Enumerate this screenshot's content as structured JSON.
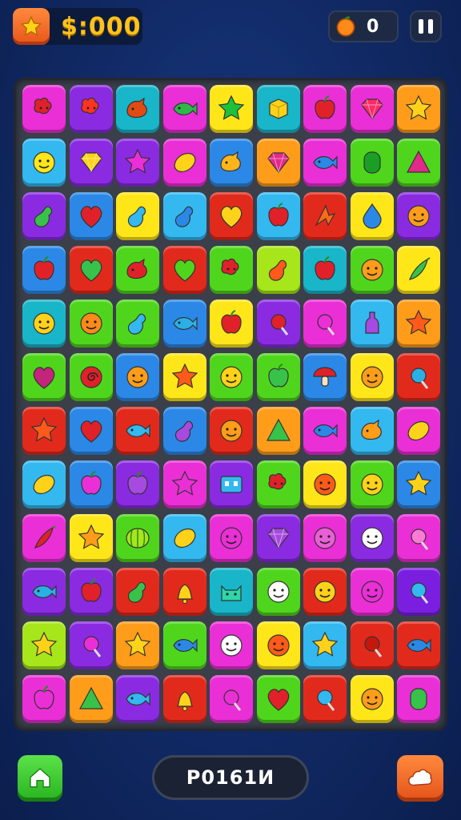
{
  "hud": {
    "coins": "$:000",
    "hearts": "0"
  },
  "bottom": {
    "status_label": "P0161И"
  },
  "colors": {
    "red": "#e22a1c",
    "purple": "#8a2be2",
    "teal": "#19b5c9",
    "magenta": "#ea2fd6",
    "yellow": "#ffe619",
    "blue": "#2b88e6",
    "orange": "#ff9d1a",
    "green": "#4fd61c",
    "sky": "#33b8f0",
    "lime": "#a6e61a",
    "darkred": "#c4180f",
    "violet": "#7a1fe0"
  },
  "board": {
    "rows": [
      [
        [
          "magenta",
          "blob",
          "#e0212a"
        ],
        [
          "purple",
          "blob",
          "#ff3322"
        ],
        [
          "teal",
          "bird",
          "#e24a12"
        ],
        [
          "magenta",
          "fish",
          "#2fb84a"
        ],
        [
          "yellow",
          "star",
          "#1ec23a"
        ],
        [
          "teal",
          "cube",
          "#ffd21a"
        ],
        [
          "magenta",
          "apple",
          "#e0212a"
        ],
        [
          "magenta",
          "gem",
          "#ff2a6a"
        ],
        [
          "orange",
          "star",
          "#ffd21a"
        ]
      ],
      [
        [
          "sky",
          "face",
          "#ffe619"
        ],
        [
          "purple",
          "gem",
          "#ffd21a"
        ],
        [
          "purple",
          "star",
          "#ea2fd6"
        ],
        [
          "magenta",
          "lemon",
          "#ffd21a"
        ],
        [
          "blue",
          "bird",
          "#ffb51a"
        ],
        [
          "orange",
          "gem",
          "#e22a8a"
        ],
        [
          "magenta",
          "fish",
          "#2b88e6"
        ],
        [
          "green",
          "jelly",
          "#1b9e25"
        ],
        [
          "green",
          "tri",
          "#e22a8a"
        ]
      ],
      [
        [
          "purple",
          "pear",
          "#38c24a"
        ],
        [
          "blue",
          "heart",
          "#e0212a"
        ],
        [
          "yellow",
          "pear",
          "#33b8f0"
        ],
        [
          "sky",
          "pear",
          "#2b88e6"
        ],
        [
          "red",
          "heart",
          "#ffd21a"
        ],
        [
          "sky",
          "apple",
          "#e0212a"
        ],
        [
          "red",
          "arrow",
          "#ff6a1a"
        ],
        [
          "yellow",
          "drop",
          "#2b88e6"
        ],
        [
          "purple",
          "face",
          "#ff9d1a"
        ]
      ],
      [
        [
          "blue",
          "apple",
          "#e0212a"
        ],
        [
          "red",
          "heart",
          "#38c24a"
        ],
        [
          "green",
          "bird",
          "#e0212a"
        ],
        [
          "red",
          "heart",
          "#4fd61c"
        ],
        [
          "green",
          "blob",
          "#e0212a"
        ],
        [
          "lime",
          "pear",
          "#ff5a1a"
        ],
        [
          "teal",
          "apple",
          "#e0212a"
        ],
        [
          "green",
          "face",
          "#ff9d1a"
        ],
        [
          "yellow",
          "pepper",
          "#38c24a"
        ]
      ],
      [
        [
          "teal",
          "face",
          "#ffd21a"
        ],
        [
          "green",
          "face",
          "#ff8a1a"
        ],
        [
          "green",
          "pear",
          "#33b8f0"
        ],
        [
          "blue",
          "fish",
          "#2bb0e6"
        ],
        [
          "yellow",
          "apple",
          "#e0212a"
        ],
        [
          "purple",
          "candy",
          "#e0212a"
        ],
        [
          "magenta",
          "candy",
          "#ea2fd6"
        ],
        [
          "sky",
          "bottle",
          "#a64ae0"
        ],
        [
          "orange",
          "star",
          "#ff5a1a"
        ]
      ],
      [
        [
          "green",
          "heart",
          "#c4247a"
        ],
        [
          "green",
          "swirl",
          "#e0212a"
        ],
        [
          "blue",
          "face",
          "#ff9d1a"
        ],
        [
          "yellow",
          "star",
          "#ff5a1a"
        ],
        [
          "green",
          "face",
          "#ffd21a"
        ],
        [
          "green",
          "apple",
          "#38c24a"
        ],
        [
          "blue",
          "mushroom",
          "#e0212a"
        ],
        [
          "yellow",
          "face",
          "#ff9d1a"
        ],
        [
          "red",
          "candy",
          "#2bb0e6"
        ]
      ],
      [
        [
          "red",
          "star",
          "#ff5a1a"
        ],
        [
          "blue",
          "heart",
          "#e0212a"
        ],
        [
          "red",
          "fish",
          "#33b8f0"
        ],
        [
          "blue",
          "pear",
          "#a64ae0"
        ],
        [
          "red",
          "face",
          "#ff9d1a"
        ],
        [
          "orange",
          "tri",
          "#38c24a"
        ],
        [
          "magenta",
          "fish",
          "#2b88e6"
        ],
        [
          "sky",
          "bird",
          "#ff9d1a"
        ],
        [
          "magenta",
          "lemon",
          "#ffd21a"
        ]
      ],
      [
        [
          "sky",
          "lemon",
          "#ffd21a"
        ],
        [
          "blue",
          "apple",
          "#ea2fd6"
        ],
        [
          "purple",
          "apple",
          "#a64ae0"
        ],
        [
          "magenta",
          "star",
          "#ea2fd6"
        ],
        [
          "purple",
          "robot",
          "#33b8f0"
        ],
        [
          "green",
          "blob",
          "#e0212a"
        ],
        [
          "yellow",
          "face",
          "#ff5a1a"
        ],
        [
          "green",
          "face",
          "#ffd21a"
        ],
        [
          "blue",
          "star",
          "#ffd21a"
        ]
      ],
      [
        [
          "magenta",
          "pepper",
          "#e0212a"
        ],
        [
          "yellow",
          "star",
          "#ff9d1a"
        ],
        [
          "green",
          "melon",
          "#a6e61a"
        ],
        [
          "sky",
          "lemon",
          "#ffd21a"
        ],
        [
          "magenta",
          "face",
          "#ea2fd6"
        ],
        [
          "purple",
          "gem",
          "#a64ae0"
        ],
        [
          "magenta",
          "face",
          "#ea5fd6"
        ],
        [
          "purple",
          "face",
          "#ffffff"
        ],
        [
          "magenta",
          "candy",
          "#ff7ad6"
        ]
      ],
      [
        [
          "purple",
          "fish",
          "#2bb0e6"
        ],
        [
          "purple",
          "apple",
          "#e0212a"
        ],
        [
          "red",
          "pear",
          "#38c24a"
        ],
        [
          "red",
          "bell",
          "#ffd21a"
        ],
        [
          "teal",
          "cat",
          "#2fd6a8"
        ],
        [
          "green",
          "face",
          "#ffffff"
        ],
        [
          "red",
          "face",
          "#ffd21a"
        ],
        [
          "magenta",
          "face",
          "#ea2fd6"
        ],
        [
          "violet",
          "candy",
          "#33b8f0"
        ]
      ],
      [
        [
          "lime",
          "star",
          "#ffd21a"
        ],
        [
          "purple",
          "candy",
          "#ea2fd6"
        ],
        [
          "orange",
          "star",
          "#ffd21a"
        ],
        [
          "green",
          "fish",
          "#2b88e6"
        ],
        [
          "magenta",
          "face",
          "#ffffff"
        ],
        [
          "yellow",
          "face",
          "#ff5a1a"
        ],
        [
          "sky",
          "star",
          "#ffd21a"
        ],
        [
          "red",
          "candy",
          "#c4180f"
        ],
        [
          "red",
          "fish",
          "#2b88e6"
        ]
      ],
      [
        [
          "magenta",
          "apple",
          "#ea2fd6"
        ],
        [
          "orange",
          "tri",
          "#38c24a"
        ],
        [
          "purple",
          "fish",
          "#33b8f0"
        ],
        [
          "red",
          "bell",
          "#ffd21a"
        ],
        [
          "magenta",
          "candy",
          "#ea2fd6"
        ],
        [
          "green",
          "heart",
          "#e0212a"
        ],
        [
          "red",
          "candy",
          "#33b8f0"
        ],
        [
          "yellow",
          "face",
          "#ff9d1a"
        ],
        [
          "magenta",
          "jelly",
          "#38c24a"
        ]
      ]
    ]
  }
}
